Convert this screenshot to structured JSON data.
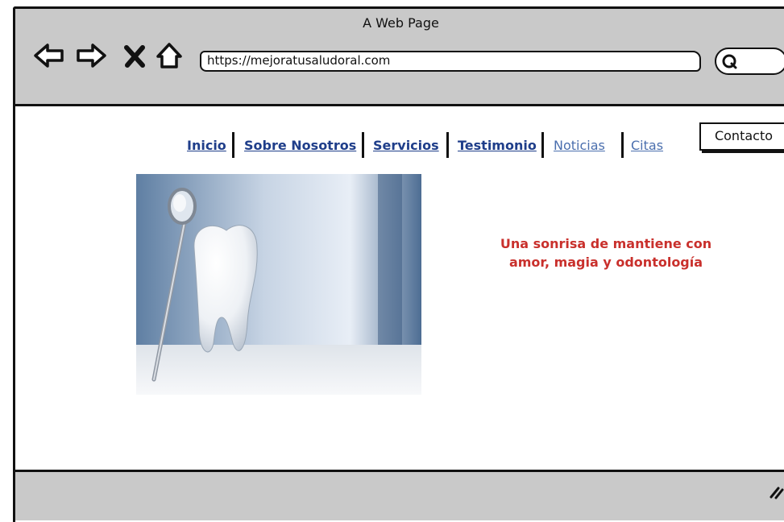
{
  "window": {
    "title": "A Web Page"
  },
  "toolbar": {
    "back_icon": "back-arrow-icon",
    "forward_icon": "forward-arrow-icon",
    "stop_icon": "close-x-icon",
    "home_icon": "home-icon",
    "url": "https://mejoratusaludoral.com",
    "search_icon": "search-icon"
  },
  "nav": {
    "items": [
      {
        "label": "Inicio"
      },
      {
        "label": "Sobre Nosotros"
      },
      {
        "label": "Servicios"
      },
      {
        "label": "Testimonio"
      },
      {
        "label": "Noticias"
      },
      {
        "label": "Citas"
      }
    ],
    "contact_label": "Contacto"
  },
  "hero": {
    "image_icon": "tooth-with-dental-mirror-image",
    "tagline_line1": "Una sonrisa de mantiene con",
    "tagline_line2": "amor, magia y odontología"
  },
  "colors": {
    "chrome_gray": "#c9c9c9",
    "link_blue": "#1f3e8a",
    "link_light_blue": "#4b6fae",
    "tagline_red": "#c9302c"
  }
}
